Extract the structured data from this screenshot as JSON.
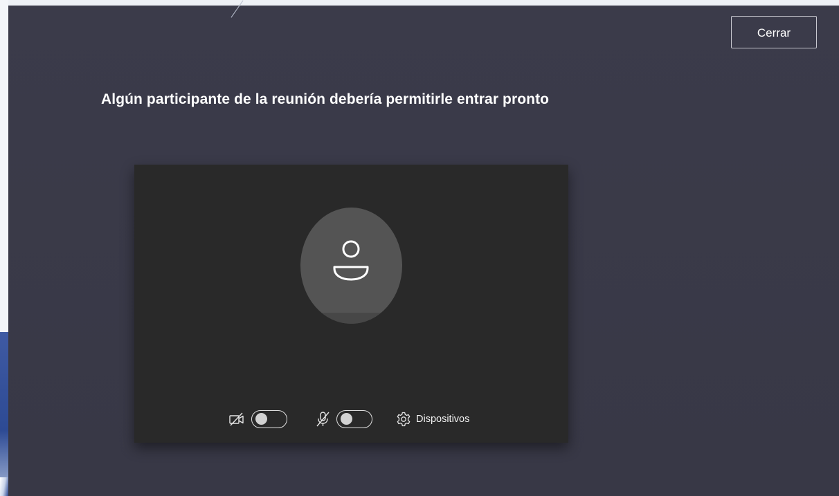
{
  "header": {
    "close_label": "Cerrar"
  },
  "main": {
    "headline": "Algún participante de la reunión debería permitirle entrar pronto"
  },
  "preview": {
    "avatar_icon": "person-icon",
    "camera": {
      "icon": "camera-off-icon",
      "enabled": false
    },
    "microphone": {
      "icon": "mic-off-icon",
      "enabled": false
    },
    "devices": {
      "icon": "gear-icon",
      "label": "Dispositivos"
    }
  },
  "colors": {
    "window_bg": "#3a3a48",
    "preview_bg": "#292929",
    "avatar_bg": "#545454",
    "text": "#ffffff"
  }
}
